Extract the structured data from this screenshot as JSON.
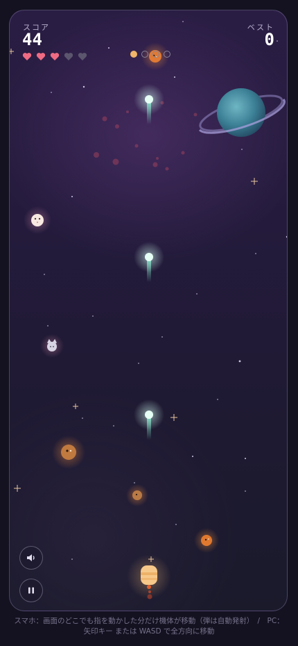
{
  "hud": {
    "score_label": "スコア",
    "score_value": "44",
    "best_label": "ベスト",
    "best_value": "0",
    "lives_total": 5,
    "lives_remaining": 3,
    "power_level": 1,
    "power_max": 4
  },
  "controls": {
    "sound_icon": "speaker-icon",
    "pause_icon": "pause-icon"
  },
  "hint": {
    "line1": "スマホ：画面のどこでも指を動かした分だけ機体が移動（弾は自動発射）　/　PC：",
    "line2": "矢印キー または WASD で全方向に移動"
  },
  "colors": {
    "heart_full": "#ef6b83",
    "heart_empty": "#5b566d",
    "accent": "#f0b46a"
  }
}
